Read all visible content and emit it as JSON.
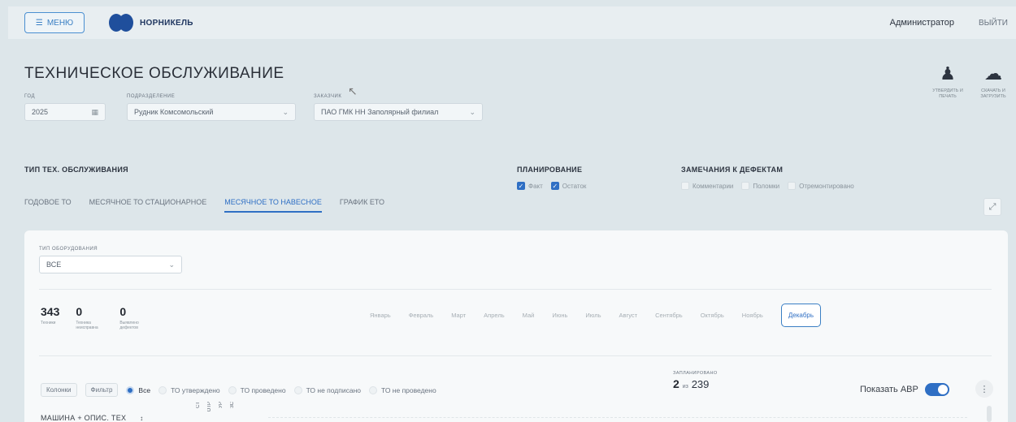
{
  "header": {
    "menu_label": "МЕНЮ",
    "logo_text": "НОРНИКЕЛЬ",
    "user_name": "Администратор",
    "logout_label": "ВЫЙТИ"
  },
  "page": {
    "title": "ТЕХНИЧЕСКОЕ ОБСЛУЖИВАНИЕ"
  },
  "filters": {
    "year": {
      "label": "ГОД",
      "value": "2025"
    },
    "division": {
      "label": "ПОДРАЗДЕЛЕНИЕ",
      "value": "Рудник Комсомольский"
    },
    "customer": {
      "label": "ЗАКАЗЧИК",
      "value": "ПАО ГМК НН Заполярный филиал"
    }
  },
  "tools": {
    "approve_label": "УТВЕРДИТЬ И ПЕЧАТЬ",
    "download_label": "СКАЧАТЬ И ЗАГРУЗИТЬ"
  },
  "maintenance_type": {
    "title": "ТИП ТЕХ. ОБСЛУЖИВАНИЯ",
    "tabs": [
      "ГОДОВОЕ ТО",
      "МЕСЯЧНОЕ ТО СТАЦИОНАРНОЕ",
      "МЕСЯЧНОЕ ТО НАВЕСНОЕ",
      "ГРАФИК ЕТО"
    ],
    "active_tab": 2
  },
  "planning": {
    "title": "ПЛАНИРОВАНИЕ",
    "options": [
      {
        "label": "Факт",
        "checked": true
      },
      {
        "label": "Остаток",
        "checked": true
      }
    ]
  },
  "remarks": {
    "title": "ЗАМЕЧАНИЯ К ДЕФЕКТАМ",
    "options": [
      {
        "label": "Комментарии",
        "checked": false
      },
      {
        "label": "Поломки",
        "checked": false
      },
      {
        "label": "Отремонтировано",
        "checked": false
      }
    ]
  },
  "equipment": {
    "label": "ТИП ОБОРУДОВАНИЯ",
    "value": "ВСЕ"
  },
  "stats": [
    {
      "value": "343",
      "label": "Техники"
    },
    {
      "value": "0",
      "label": "Техника неисправна"
    },
    {
      "value": "0",
      "label": "Выявлено дефектов"
    }
  ],
  "months": [
    "Январь",
    "Февраль",
    "Март",
    "Апрель",
    "Май",
    "Июнь",
    "Июль",
    "Август",
    "Сентябрь",
    "Октябрь",
    "Ноябрь",
    "Декабрь"
  ],
  "active_month": 11,
  "table_controls": {
    "columns_label": "Колонки",
    "filter_label": "Фильтр",
    "radios": [
      "Все",
      "ТО утверждено",
      "ТО проведено",
      "ТО не подписано",
      "ТО не проведено"
    ],
    "active_radio": 0
  },
  "planned": {
    "label": "ЗАПЛАНИРОВАНО",
    "done": "2",
    "of": "из",
    "total": "239"
  },
  "avr": {
    "label": "Показать АВР",
    "on": true
  },
  "table": {
    "first_column": "МАШИНА + ОПИС. ТЕХ",
    "vertical_headers": [
      "СТ",
      "ОТР",
      "УР",
      "ЗС"
    ]
  },
  "colors": {
    "accent": "#2f6fc4",
    "background": "#dde6ea",
    "panel": "#f7f9fa"
  }
}
